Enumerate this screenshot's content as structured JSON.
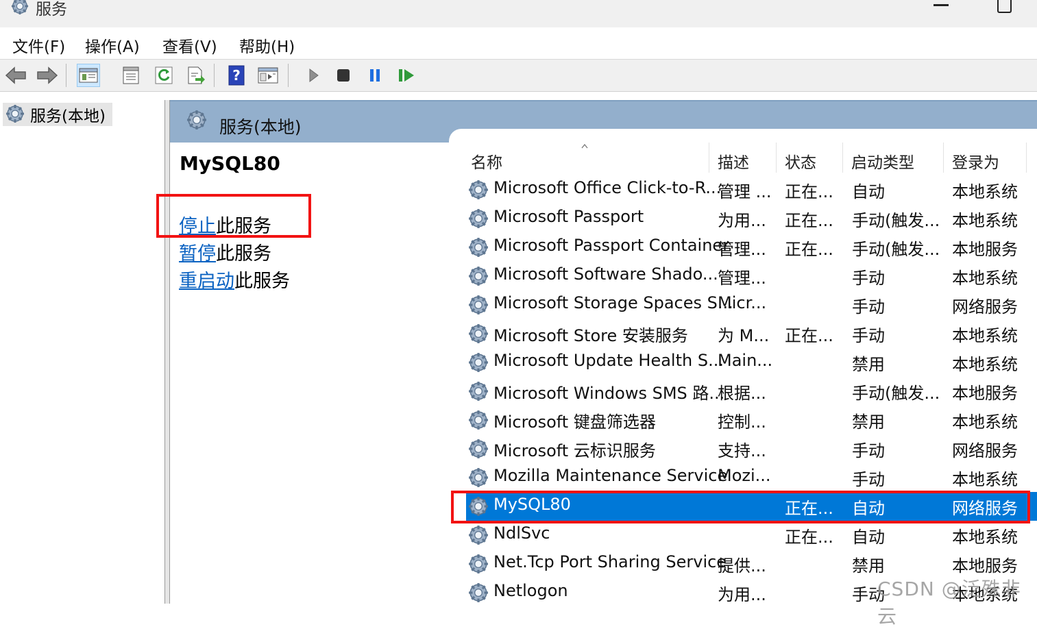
{
  "window": {
    "title": "服务"
  },
  "menu": [
    "文件(F)",
    "操作(A)",
    "查看(V)",
    "帮助(H)"
  ],
  "tree": {
    "root": "服务(本地)"
  },
  "panel": {
    "title": "服务(本地)"
  },
  "details": {
    "service_name": "MySQL80",
    "actions": [
      {
        "link": "停止",
        "suffix": "此服务"
      },
      {
        "link": "暂停",
        "suffix": "此服务"
      },
      {
        "link": "重启动",
        "suffix": "此服务"
      }
    ]
  },
  "columns": {
    "name": "名称",
    "desc": "描述",
    "status": "状态",
    "startup": "启动类型",
    "logon": "登录为"
  },
  "services": [
    {
      "name": "Microsoft Office Click-to-R...",
      "desc": "管理 ...",
      "status": "正在...",
      "startup": "自动",
      "logon": "本地系统"
    },
    {
      "name": "Microsoft Passport",
      "desc": "为用...",
      "status": "正在...",
      "startup": "手动(触发...",
      "logon": "本地系统"
    },
    {
      "name": "Microsoft Passport Container",
      "desc": "管理...",
      "status": "正在...",
      "startup": "手动(触发...",
      "logon": "本地服务"
    },
    {
      "name": "Microsoft Software Shado...",
      "desc": "管理...",
      "status": "",
      "startup": "手动",
      "logon": "本地系统"
    },
    {
      "name": "Microsoft Storage Spaces S...",
      "desc": "Micr...",
      "status": "",
      "startup": "手动",
      "logon": "网络服务"
    },
    {
      "name": "Microsoft Store 安装服务",
      "desc": "为 M...",
      "status": "正在...",
      "startup": "手动",
      "logon": "本地系统"
    },
    {
      "name": "Microsoft Update Health S...",
      "desc": "Main...",
      "status": "",
      "startup": "禁用",
      "logon": "本地系统"
    },
    {
      "name": "Microsoft Windows SMS 路...",
      "desc": "根据...",
      "status": "",
      "startup": "手动(触发...",
      "logon": "本地服务"
    },
    {
      "name": "Microsoft 键盘筛选器",
      "desc": "控制...",
      "status": "",
      "startup": "禁用",
      "logon": "本地系统"
    },
    {
      "name": "Microsoft 云标识服务",
      "desc": "支持...",
      "status": "",
      "startup": "手动",
      "logon": "网络服务"
    },
    {
      "name": "Mozilla Maintenance Service",
      "desc": "Mozi...",
      "status": "",
      "startup": "手动",
      "logon": "本地系统"
    },
    {
      "name": "MySQL80",
      "desc": "",
      "status": "正在...",
      "startup": "自动",
      "logon": "网络服务",
      "selected": true
    },
    {
      "name": "NdlSvc",
      "desc": "",
      "status": "正在...",
      "startup": "自动",
      "logon": "本地系统"
    },
    {
      "name": "Net.Tcp Port Sharing Service",
      "desc": "提供...",
      "status": "",
      "startup": "禁用",
      "logon": "本地服务"
    },
    {
      "name": "Netlogon",
      "desc": "为用...",
      "status": "",
      "startup": "手动",
      "logon": "本地系统"
    }
  ],
  "watermark": "CSDN @泛殊非云",
  "colors": {
    "selection": "#0078d7",
    "highlight_box": "#f21313",
    "link": "#0a62c2",
    "header": "#93afcc"
  }
}
